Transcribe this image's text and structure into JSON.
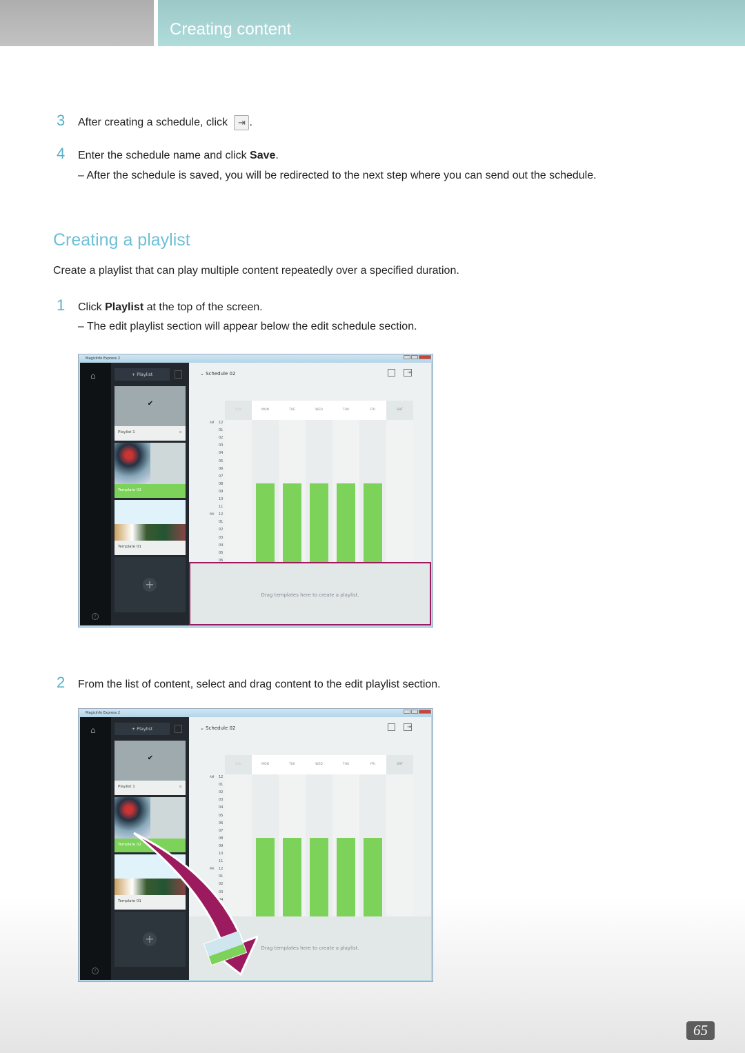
{
  "header": {
    "section_title": "Creating content"
  },
  "steps_top": [
    {
      "num": "3",
      "text": "After creating a schedule, click ",
      "icon": "export-schedule-icon",
      "after": "."
    },
    {
      "num": "4",
      "text": "Enter the schedule name and click ",
      "bold": "Save",
      "after": "."
    }
  ],
  "note_top": "–  After the schedule is saved, you will be redirected to the next step where you can send out the schedule.",
  "section": {
    "title": "Creating a playlist",
    "intro": "Create a playlist that can play multiple content repeatedly over a specified duration."
  },
  "step1": {
    "num": "1",
    "text": "Click ",
    "bold": "Playlist",
    "after": " at the top of the screen."
  },
  "note1": "–  The edit playlist section will appear below the edit schedule section.",
  "step2": {
    "num": "2",
    "text": "From the list of content, select and drag content to the edit playlist section."
  },
  "app": {
    "window_title": "MagicInfo Express 2",
    "playlist_button": "+ Playlist",
    "schedule_name": "Schedule 02",
    "cards": [
      "Playlist 1",
      "Template 02",
      "Template 01"
    ],
    "days": [
      "SUN",
      "MON",
      "TUE",
      "WED",
      "THU",
      "FRI",
      "SAT"
    ],
    "hours": [
      "12",
      "01",
      "02",
      "03",
      "04",
      "05",
      "06",
      "07",
      "08",
      "09",
      "10",
      "11",
      "12",
      "01",
      "02",
      "03",
      "04",
      "05",
      "06"
    ],
    "am_label": "AM",
    "pm_label": "PM",
    "drop_hint": "Drag templates here to create a playlist.",
    "accent_green": "#7dd35a",
    "highlight_magenta": "#9c1a5e"
  },
  "page_number": "65"
}
